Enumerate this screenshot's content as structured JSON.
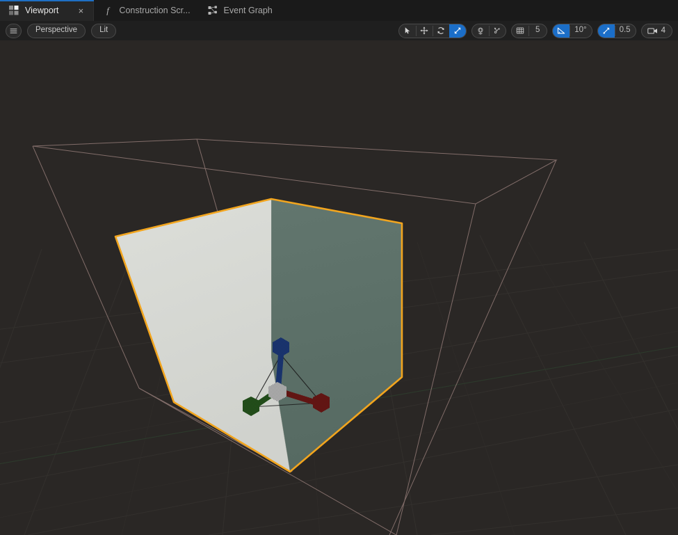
{
  "window": {
    "title": "Viewport"
  },
  "tabs": [
    {
      "label": "Viewport",
      "icon": "viewport-grid-icon",
      "active": true,
      "closable": true,
      "close_glyph": "×"
    },
    {
      "label": "Construction Scr...",
      "icon": "function-italic-f-icon",
      "active": false,
      "closable": false
    },
    {
      "label": "Event Graph",
      "icon": "node-graph-icon",
      "active": false,
      "closable": false
    }
  ],
  "viewport_toolbar": {
    "menu_button": {
      "icon": "hamburger-menu-icon",
      "label": ""
    },
    "camera_mode": {
      "label": "Perspective"
    },
    "view_mode": {
      "label": "Lit"
    },
    "transform_tools": [
      {
        "name": "select-tool",
        "icon": "cursor-arrow-icon",
        "active": false
      },
      {
        "name": "translate-tool",
        "icon": "move-arrows-icon",
        "active": false
      },
      {
        "name": "rotate-tool",
        "icon": "rotate-arrows-icon",
        "active": false
      },
      {
        "name": "scale-tool",
        "icon": "scale-diagonal-icon",
        "active": true
      }
    ],
    "space_tools": [
      {
        "name": "world-space-toggle",
        "icon": "globe-axis-icon",
        "active": false
      },
      {
        "name": "surface-snap-toggle",
        "icon": "surface-snap-icon",
        "active": false
      }
    ],
    "grid_snap": {
      "icon": "grid-snap-icon",
      "active": false,
      "value": "5"
    },
    "angle_snap": {
      "icon": "angle-snap-icon",
      "active": true,
      "value": "10°"
    },
    "scale_snap": {
      "icon": "scale-snap-icon",
      "active": true,
      "value": "0.5"
    },
    "camera_speed": {
      "icon": "camera-icon",
      "value": "4"
    }
  },
  "scene": {
    "background_color": "#2a2725",
    "grid_line_color": "#34312e",
    "bounds_wire_color": "#8a7470",
    "selection_outline_color": "#f2a51e",
    "cube": {
      "face_left_color": "#d6d8d3",
      "face_right_color": "#5c7069",
      "face_top_color": "#dcded9"
    },
    "gizmo": {
      "type": "scale-gizmo",
      "axes": [
        {
          "name": "x-axis-handle",
          "color": "#2a5f20"
        },
        {
          "name": "y-axis-handle",
          "color": "#7a1a18"
        },
        {
          "name": "z-axis-handle",
          "color": "#1f3f87"
        }
      ],
      "center": {
        "name": "uniform-scale-handle",
        "color": "#c8c8c8"
      }
    }
  },
  "colors": {
    "accent_blue": "#1b6ec8",
    "tab_active_bg": "#262626",
    "toolbar_bg": "#1f1f1f",
    "tabbar_bg": "#1a1a1a"
  }
}
